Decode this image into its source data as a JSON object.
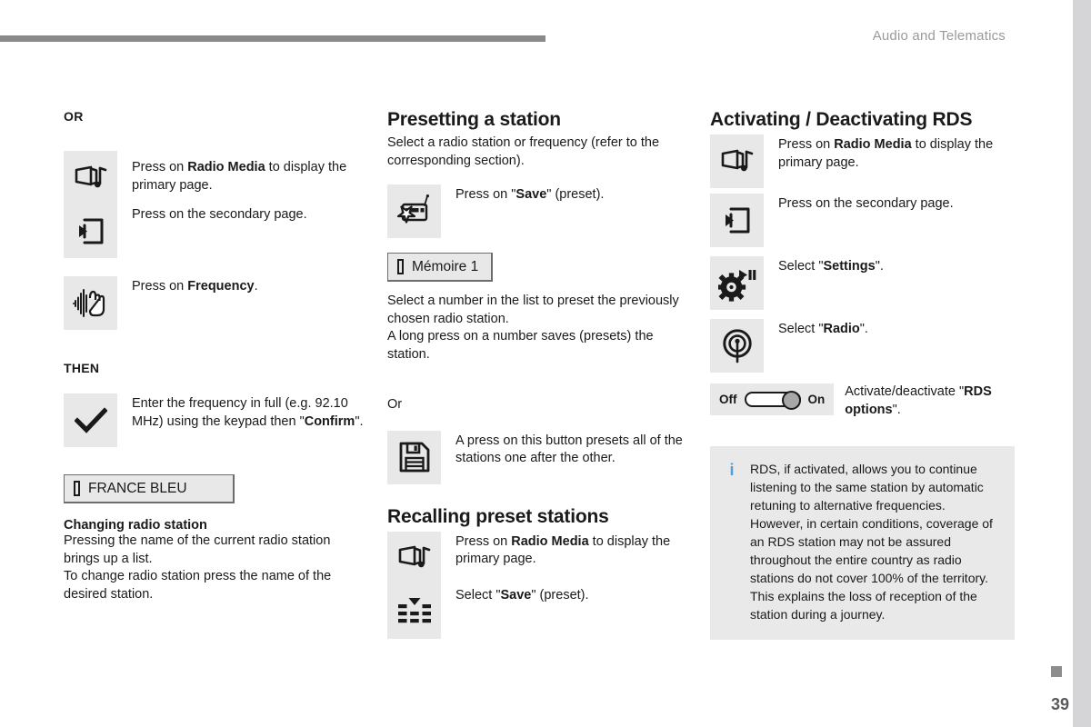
{
  "header": {
    "title": "Audio and Telematics"
  },
  "footer": {
    "page_number": "39"
  },
  "column_1": {
    "or_label": "OR",
    "then_label": "THEN",
    "steps": [
      {
        "icon": "radio-media-icon",
        "text_html": "Press on <b>Radio Media</b> to display the primary page."
      },
      {
        "icon": "secondary-page-icon",
        "text_html": "Press on the secondary page."
      },
      {
        "icon": "frequency-waveform-icon",
        "text_html": "Press on <b>Frequency</b>."
      }
    ],
    "then_step": {
      "icon": "check-mark-icon",
      "text_html": "Enter the frequency in full (e.g. 92.10 MHz) using the keypad then \"<b>Confirm</b>\"."
    },
    "station_button": "FRANCE BLEU",
    "changing_station": {
      "heading": "Changing radio station",
      "body": "Pressing the name of the current radio station brings up a list.\nTo change radio station press the name of the desired station."
    }
  },
  "column_2": {
    "title": "Presetting a station",
    "intro": "Select a radio station or frequency (refer to the corresponding section).",
    "save_step": {
      "icon": "radio-star-save-icon",
      "text_html": "Press on \"<b>Save</b>\" (preset)."
    },
    "memory_button": "Mémoire 1",
    "memory_note": "Select a number in the list to preset the previously chosen radio station.\nA long press on a number saves (presets) the station.",
    "or_label": "Or",
    "preset_all_step": {
      "icon": "floppy-disk-icon",
      "text_html": "A press on this button presets all of the stations one after the other."
    },
    "recall_title": "Recalling preset stations",
    "recall_steps": [
      {
        "icon": "radio-media-icon",
        "text_html": "Press on <b>Radio Media</b> to display the primary page."
      },
      {
        "icon": "preset-list-icon",
        "text_html": "Select \"<b>Save</b>\" (preset)."
      }
    ]
  },
  "column_3": {
    "title": "Activating / Deactivating RDS",
    "steps": [
      {
        "icon": "radio-media-icon",
        "text_html": "Press on <b>Radio Media</b> to display the primary page."
      },
      {
        "icon": "secondary-page-icon",
        "text_html": "Press on the secondary page."
      },
      {
        "icon": "settings-gear-icon",
        "text_html": "Select \"<b>Settings</b>\"."
      },
      {
        "icon": "radio-antenna-icon",
        "text_html": "Select \"<b>Radio</b>\"."
      }
    ],
    "toggle": {
      "off_label": "Off",
      "on_label": "On",
      "state": "on",
      "text_html": "Activate/deactivate \"<b>RDS options</b>\"."
    },
    "info": {
      "icon": "info-icon",
      "text": "RDS, if activated, allows you to continue listening to the same station by automatic retuning to alternative frequencies. However, in certain conditions, coverage of an RDS station may not be assured throughout the entire country as radio stations do not cover 100% of the territory. This explains the loss of reception of the station during a journey."
    }
  },
  "colors": {
    "icon_background": "#e8e8e8",
    "header_rule": "#898989",
    "header_text": "#9a9a9c",
    "info_accent": "#4d9fd6",
    "page_edge": "#d5d5d7"
  }
}
